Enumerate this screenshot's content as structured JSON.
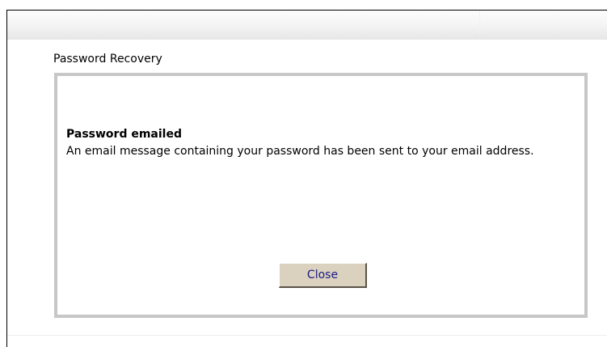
{
  "section": {
    "title": "Password Recovery"
  },
  "message": {
    "title": "Password emailed",
    "body": "An email message containing your password has been sent to your email address."
  },
  "actions": {
    "close_label": "Close"
  },
  "colors": {
    "panel_border": "#c7c7c7",
    "button_face": "#dad1bf",
    "button_text": "#1b1a83"
  }
}
